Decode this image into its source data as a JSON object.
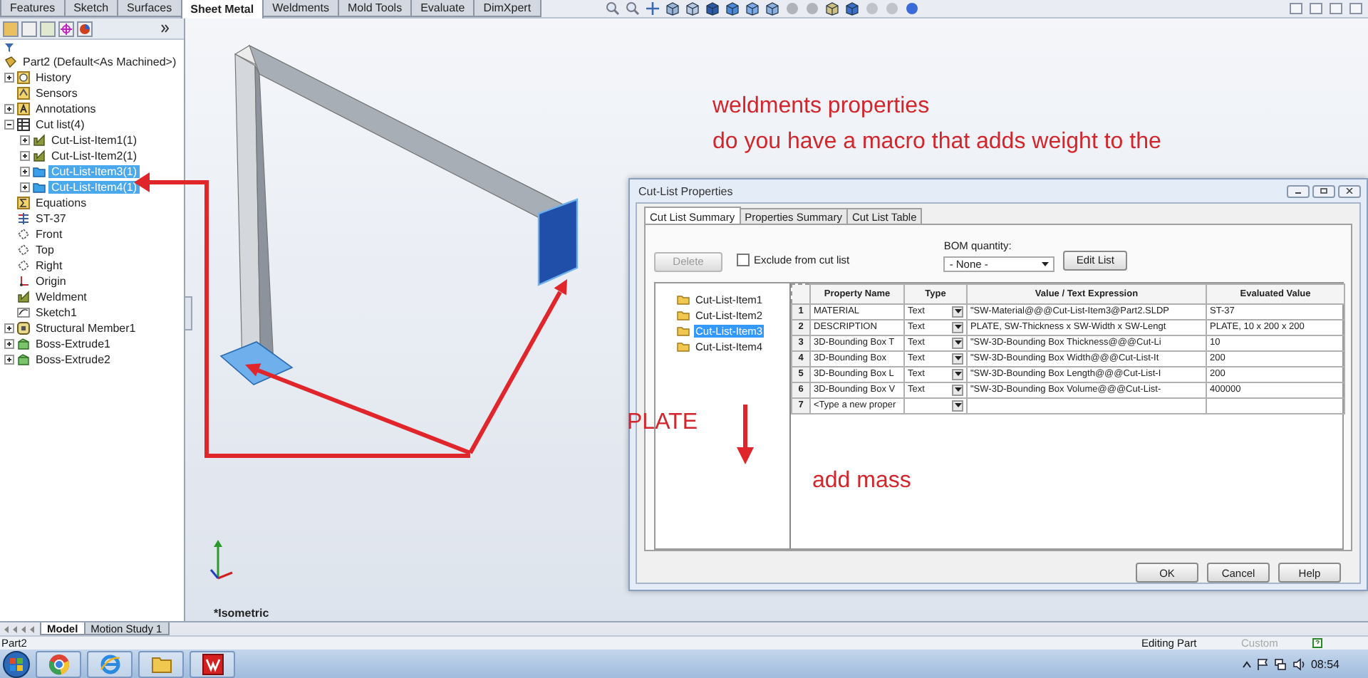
{
  "command_tabs": [
    {
      "label": "Features",
      "selected": false
    },
    {
      "label": "Sketch",
      "selected": false
    },
    {
      "label": "Surfaces",
      "selected": false
    },
    {
      "label": "Sheet Metal",
      "selected": true
    },
    {
      "label": "Weldments",
      "selected": false
    },
    {
      "label": "Mold Tools",
      "selected": false
    },
    {
      "label": "Evaluate",
      "selected": false
    },
    {
      "label": "DimXpert",
      "selected": false
    }
  ],
  "feature_tree": {
    "root": "Part2  (Default<As Machined>)",
    "items": [
      {
        "label": "History",
        "kind": "history",
        "expanded": false,
        "selected": false
      },
      {
        "label": "Sensors",
        "kind": "sensors",
        "selected": false
      },
      {
        "label": "Annotations",
        "kind": "annotations",
        "expanded": false,
        "selected": false
      },
      {
        "label": "Cut list(4)",
        "kind": "cutlist",
        "expanded": true,
        "selected": false,
        "children": [
          {
            "label": "Cut-List-Item1(1)",
            "kind": "weldment",
            "expanded": false,
            "selected": false
          },
          {
            "label": "Cut-List-Item2(1)",
            "kind": "weldment",
            "expanded": false,
            "selected": false
          },
          {
            "label": "Cut-List-Item3(1)",
            "kind": "folder",
            "expanded": false,
            "selected": true
          },
          {
            "label": "Cut-List-Item4(1)",
            "kind": "folder",
            "expanded": false,
            "selected": true
          }
        ]
      },
      {
        "label": "Equations",
        "kind": "equations",
        "selected": false
      },
      {
        "label": "ST-37",
        "kind": "material",
        "selected": false
      },
      {
        "label": "Front",
        "kind": "plane",
        "selected": false
      },
      {
        "label": "Top",
        "kind": "plane",
        "selected": false
      },
      {
        "label": "Right",
        "kind": "plane",
        "selected": false
      },
      {
        "label": "Origin",
        "kind": "origin",
        "selected": false
      },
      {
        "label": "Weldment",
        "kind": "weldment",
        "selected": false
      },
      {
        "label": "Sketch1",
        "kind": "sketch",
        "selected": false
      },
      {
        "label": "Structural Member1",
        "kind": "structural",
        "expanded": false,
        "selected": false
      },
      {
        "label": "Boss-Extrude1",
        "kind": "extrude",
        "expanded": false,
        "selected": false
      },
      {
        "label": "Boss-Extrude2",
        "kind": "extrude",
        "expanded": false,
        "selected": false
      }
    ]
  },
  "viewport": {
    "view_label": "*Isometric",
    "notes": [
      "weldments properties",
      "do you have a macro that adds weight to the",
      "PLATE",
      "add mass"
    ]
  },
  "dialog": {
    "title": "Cut-List Properties",
    "tabs": [
      {
        "label": "Cut List Summary",
        "selected": true
      },
      {
        "label": "Properties Summary",
        "selected": false
      },
      {
        "label": "Cut List Table",
        "selected": false
      }
    ],
    "delete_button": {
      "label": "Delete",
      "disabled": true
    },
    "exclude_checkbox": {
      "label": "Exclude from cut list",
      "checked": false
    },
    "bom_quantity": {
      "label": "BOM quantity:",
      "value": "- None -"
    },
    "edit_list_button": "Edit List",
    "items": [
      {
        "label": "Cut-List-Item1",
        "selected": false
      },
      {
        "label": "Cut-List-Item2",
        "selected": false
      },
      {
        "label": "Cut-List-Item3",
        "selected": true
      },
      {
        "label": "Cut-List-Item4",
        "selected": false
      }
    ],
    "table": {
      "columns": [
        "Property Name",
        "Type",
        "Value / Text Expression",
        "Evaluated Value"
      ],
      "rows": [
        {
          "kind": "property",
          "number": "1",
          "property_name": "MATERIAL",
          "type": "Text",
          "value": "\"SW-Material@@@Cut-List-Item3@Part2.SLDP",
          "evaluated": "ST-37"
        },
        {
          "kind": "property",
          "number": "2",
          "property_name": "DESCRIPTION",
          "type": "Text",
          "value": "PLATE, SW-Thickness x SW-Width x SW-Lengt",
          "evaluated": "PLATE, 10 x 200 x 200"
        },
        {
          "kind": "property",
          "number": "3",
          "property_name": "3D-Bounding Box T",
          "type": "Text",
          "value": "\"SW-3D-Bounding Box Thickness@@@Cut-Li",
          "evaluated": "10"
        },
        {
          "kind": "property",
          "number": "4",
          "property_name": "3D-Bounding Box",
          "type": "Text",
          "value": "\"SW-3D-Bounding Box Width@@@Cut-List-It",
          "evaluated": "200"
        },
        {
          "kind": "property",
          "number": "5",
          "property_name": "3D-Bounding Box L",
          "type": "Text",
          "value": "\"SW-3D-Bounding Box Length@@@Cut-List-I",
          "evaluated": "200"
        },
        {
          "kind": "property",
          "number": "6",
          "property_name": "3D-Bounding Box V",
          "type": "Text",
          "value": "\"SW-3D-Bounding Box Volume@@@Cut-List-",
          "evaluated": "400000"
        },
        {
          "kind": "new",
          "number": "7",
          "placeholder": "<Type a new proper"
        }
      ]
    },
    "buttons": [
      "OK",
      "Cancel",
      "Help"
    ]
  },
  "bottom_tabs": [
    {
      "label": "Model",
      "selected": true
    },
    {
      "label": "Motion Study 1",
      "selected": false
    }
  ],
  "status_bar": {
    "document": "Part2",
    "mode": "Editing Part",
    "units": "Custom"
  },
  "taskbar": {
    "clock": "08:54"
  }
}
